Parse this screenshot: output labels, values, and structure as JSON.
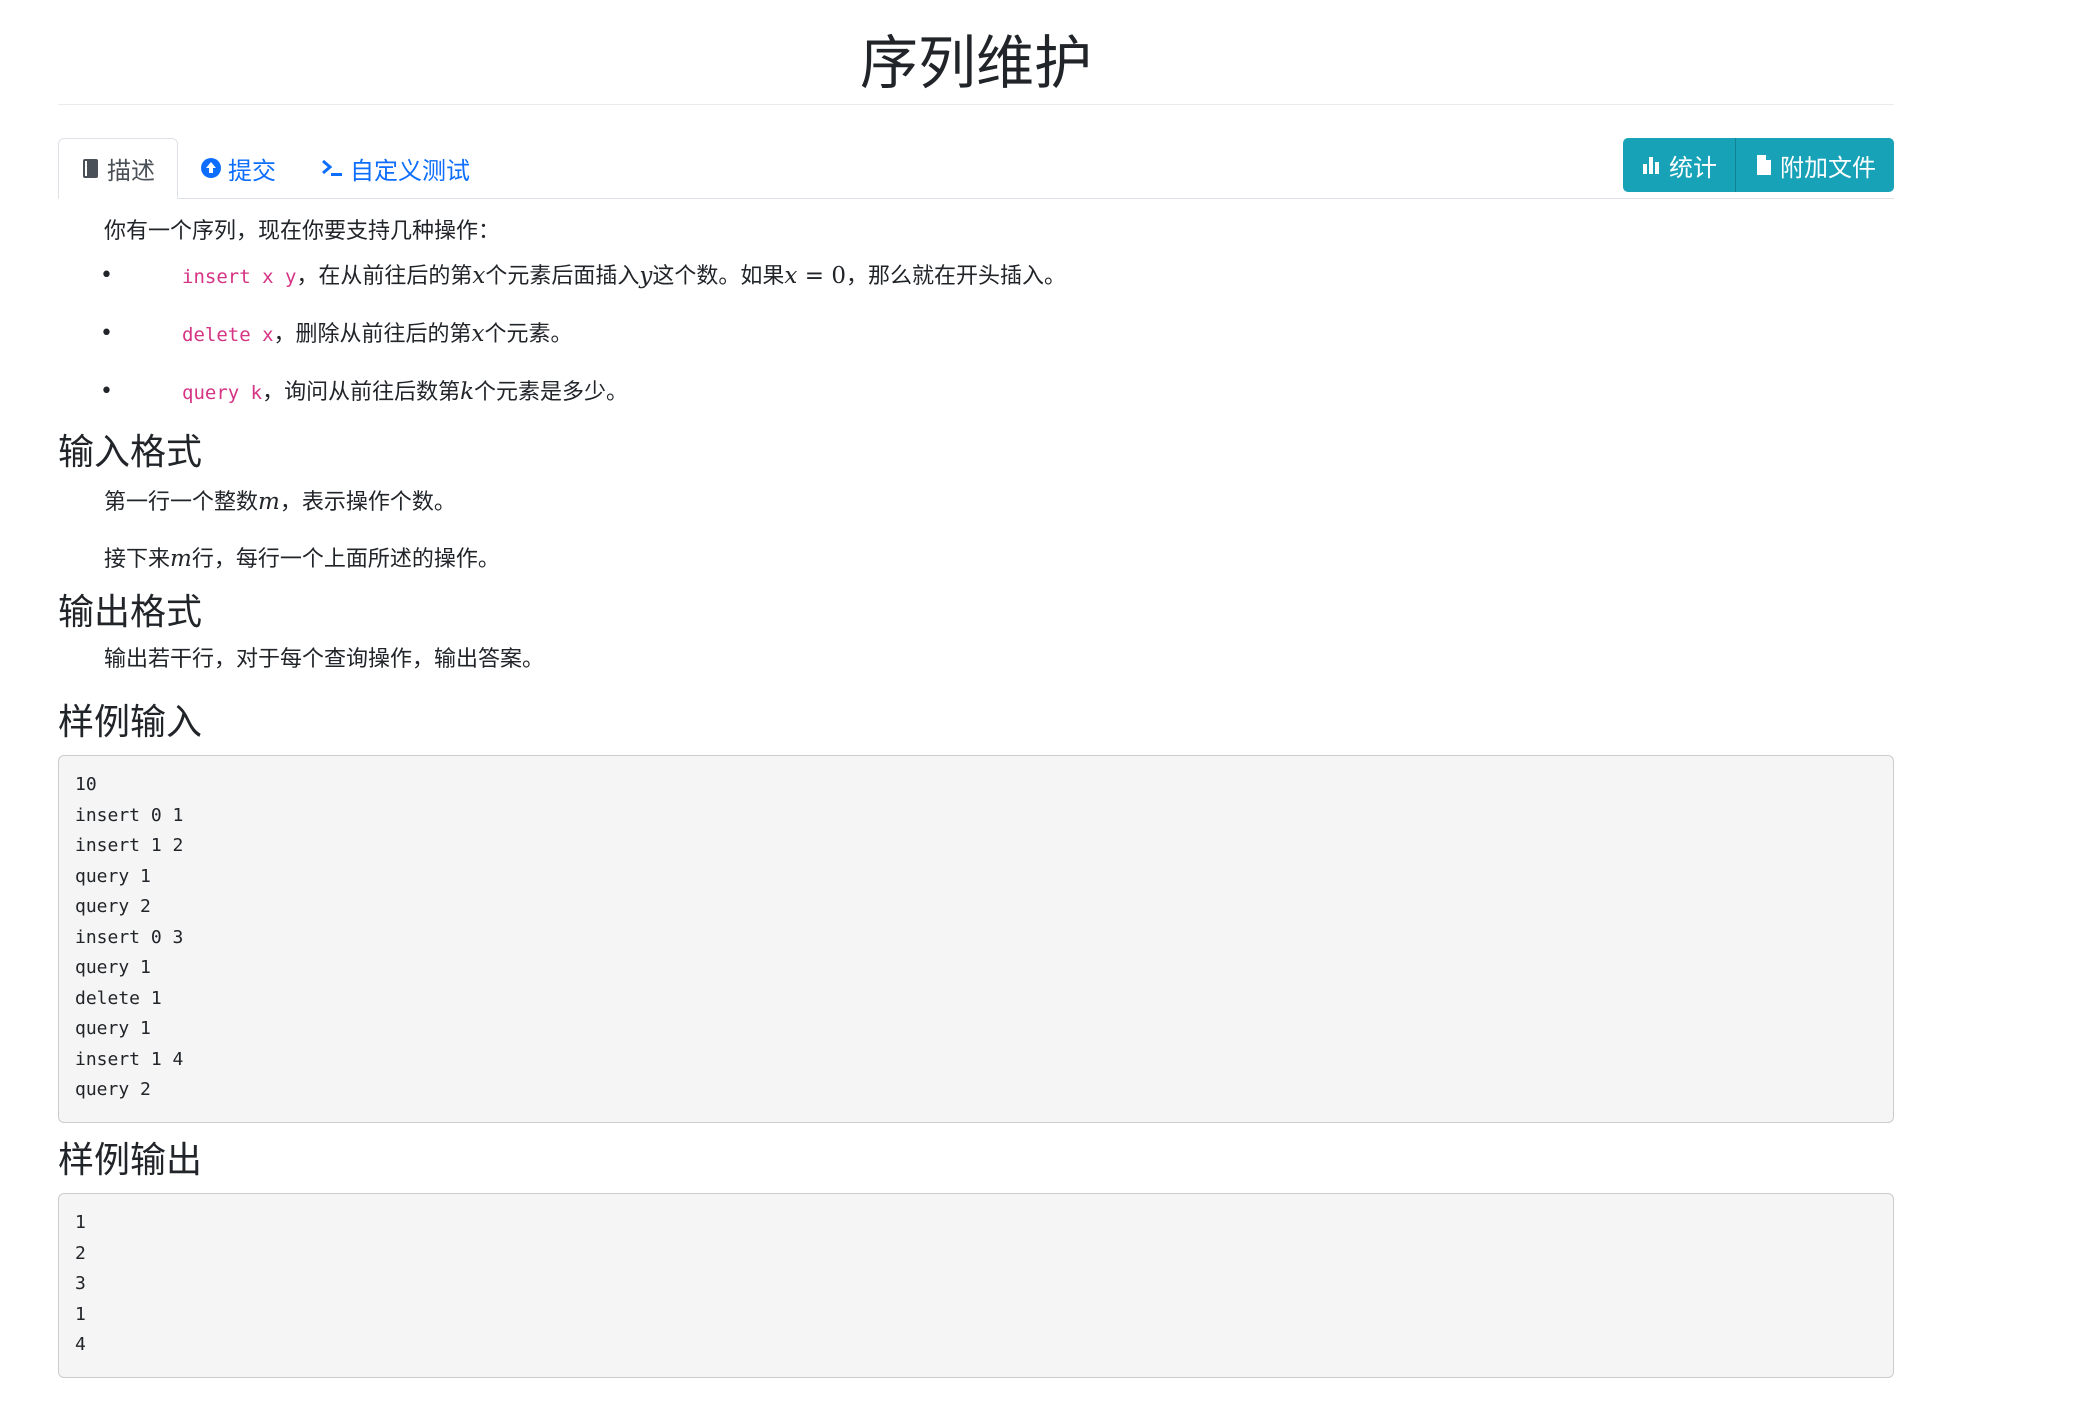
{
  "problem": {
    "title": "序列维护"
  },
  "tabs": [
    {
      "label": "描述",
      "icon": "book-icon",
      "active": true
    },
    {
      "label": "提交",
      "icon": "arrow-circle-up-icon",
      "active": false
    },
    {
      "label": "自定义测试",
      "icon": "terminal-icon",
      "active": false
    }
  ],
  "actions": {
    "stats_label": "统计",
    "stats_icon": "bar-chart-icon",
    "attachments_label": "附加文件",
    "attachments_icon": "file-icon"
  },
  "description": {
    "intro": "你有一个序列，现在你要支持几种操作：",
    "ops": [
      {
        "code": "insert x y",
        "text_a": "，在从前往后的第",
        "var1": "x",
        "text_b": "个元素后面插入",
        "var2": "y",
        "text_c": "这个数。如果",
        "eq_var": "x",
        "eq_op": " = ",
        "eq_val": "0",
        "text_d": "，那么就在开头插入。"
      },
      {
        "code": "delete x",
        "text_a": "，删除从前往后的第",
        "var1": "x",
        "text_b": "个元素。"
      },
      {
        "code": "query k",
        "text_a": "，询问从前往后数第",
        "var1": "k",
        "text_b": "个元素是多少。"
      }
    ]
  },
  "input_format": {
    "heading": "输入格式",
    "line1_a": "第一行一个整数",
    "line1_var": "m",
    "line1_b": "，表示操作个数。",
    "line2_a": "接下来",
    "line2_var": "m",
    "line2_b": "行，每行一个上面所述的操作。"
  },
  "output_format": {
    "heading": "输出格式",
    "text": "输出若干行，对于每个查询操作，输出答案。"
  },
  "sample_input": {
    "heading": "样例输入",
    "content": "10\ninsert 0 1\ninsert 1 2\nquery 1\nquery 2\ninsert 0 3\nquery 1\ndelete 1\nquery 1\ninsert 1 4\nquery 2"
  },
  "sample_output": {
    "heading": "样例输出",
    "content": "1\n2\n3\n1\n4"
  },
  "colors": {
    "link": "#0d6efd",
    "button": "#17a2b8",
    "code": "#d63384",
    "pre_bg": "#f5f5f5"
  }
}
